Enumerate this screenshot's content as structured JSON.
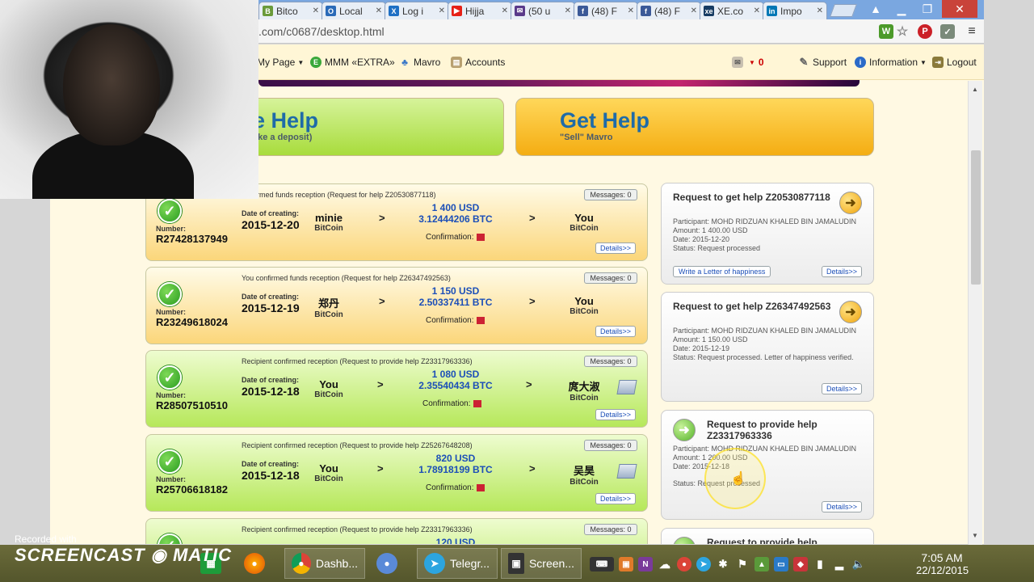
{
  "browser": {
    "tabs": [
      {
        "label": "Bitco",
        "icon_color": "#6a9a3a",
        "icon": "bitcoin-icon",
        "glyph": "B"
      },
      {
        "label": "Local",
        "icon_color": "#2a6ab8",
        "icon": "circle-icon",
        "glyph": "O"
      },
      {
        "label": "Log i",
        "icon_color": "#1e6fc4",
        "icon": "close-x-icon",
        "glyph": "X"
      },
      {
        "label": "Hijja",
        "icon_color": "#e62117",
        "icon": "youtube-icon",
        "glyph": "▶"
      },
      {
        "label": "(50 u",
        "icon_color": "#5a3a8a",
        "icon": "mail-icon",
        "glyph": "✉"
      },
      {
        "label": "(48) F",
        "icon_color": "#3b5998",
        "icon": "facebook-icon",
        "glyph": "f"
      },
      {
        "label": "(48) F",
        "icon_color": "#3b5998",
        "icon": "facebook-icon",
        "glyph": "f"
      },
      {
        "label": "XE.co",
        "icon_color": "#163b63",
        "icon": "xe-icon",
        "glyph": "xe"
      },
      {
        "label": "Impo",
        "icon_color": "#0077b5",
        "icon": "linkedin-icon",
        "glyph": "in"
      }
    ],
    "url": ".com/c0687/desktop.html"
  },
  "nav": {
    "my_page": "My Page",
    "mmm_extra": "MMM «EXTRA»",
    "mavro": "Mavro",
    "accounts": "Accounts",
    "mail_count": "0",
    "support": "Support",
    "information": "Information",
    "logout": "Logout"
  },
  "actions": {
    "provide_title": "e Help",
    "provide_sub": "ake a deposit)",
    "get_title": "Get Help",
    "get_sub": "\"Sell\" Mavro"
  },
  "transactions": [
    {
      "header": "confirmed funds reception (Request for help Z20530877118)",
      "messages": "Messages: 0",
      "number_label": "Number:",
      "number": "R27428137949",
      "date_label": "Date of creating:",
      "date": "2015-12-20",
      "from_name": "minie",
      "from_currency": "BitCoin",
      "usd": "1 400 USD",
      "btc": "3.12444206 BTC",
      "to_name": "You",
      "to_currency": "BitCoin",
      "confirmation": "Confirmation:",
      "details": "Details>>"
    },
    {
      "header": "You confirmed funds reception (Request for help Z26347492563)",
      "messages": "Messages: 0",
      "number_label": "Number:",
      "number": "R23249618024",
      "date_label": "Date of creating:",
      "date": "2015-12-19",
      "from_name": "郑丹",
      "from_currency": "BitCoin",
      "usd": "1 150 USD",
      "btc": "2.50337411 BTC",
      "to_name": "You",
      "to_currency": "BitCoin",
      "confirmation": "Confirmation:",
      "details": "Details>>"
    },
    {
      "header": "Recipient confirmed reception (Request to provide help Z23317963336)",
      "messages": "Messages: 0",
      "number_label": "Number:",
      "number": "R28507510510",
      "date_label": "Date of creating:",
      "date": "2015-12-18",
      "from_name": "You",
      "from_currency": "BitCoin",
      "usd": "1 080 USD",
      "btc": "2.35540434 BTC",
      "to_name": "庹大淑",
      "to_currency": "BitCoin",
      "confirmation": "Confirmation:",
      "details": "Details>>"
    },
    {
      "header": "Recipient confirmed reception (Request to provide help Z25267648208)",
      "messages": "Messages: 0",
      "number_label": "Number:",
      "number": "R25706618182",
      "date_label": "Date of creating:",
      "date": "2015-12-18",
      "from_name": "You",
      "from_currency": "BitCoin",
      "usd": "820 USD",
      "btc": "1.78918199 BTC",
      "to_name": "吴昊",
      "to_currency": "BitCoin",
      "confirmation": "Confirmation:",
      "details": "Details>>"
    },
    {
      "header": "Recipient confirmed reception (Request to provide help Z23317963336)",
      "messages": "Messages: 0",
      "usd": "120 USD"
    }
  ],
  "requests": [
    {
      "title": "Request to get help Z20530877118",
      "participant": "Participant: MOHD RIDZUAN KHALED BIN JAMALUDIN",
      "amount": "Amount: 1 400.00 USD",
      "date": "Date: 2015-12-20",
      "status": "Status: Request processed",
      "letter": "Write a Letter of happiness",
      "details": "Details>>"
    },
    {
      "title": "Request to get help Z26347492563",
      "participant": "Participant: MOHD RIDZUAN KHALED BIN JAMALUDIN",
      "amount": "Amount: 1 150.00 USD",
      "date": "Date: 2015-12-19",
      "status": "Status: Request processed. Letter of happiness verified.",
      "details": "Details>>"
    },
    {
      "title": "Request to provide help Z23317963336",
      "participant": "Participant: MOHD RIDZUAN KHALED BIN JAMALUDIN",
      "amount": "Amount: 1 200.00 USD",
      "date": "Date: 2015-12-18",
      "status": "Status: Request processed",
      "details": "Details>>"
    },
    {
      "title": "Request to provide help"
    }
  ],
  "watermark": {
    "top": "Recorded with",
    "main": "SCREENCAST ◉ MATIC"
  },
  "taskbar": {
    "dashboard": "Dashb...",
    "telegram": "Telegr...",
    "screencast": "Screen...",
    "time": "7:05 AM",
    "date": "22/12/2015"
  }
}
